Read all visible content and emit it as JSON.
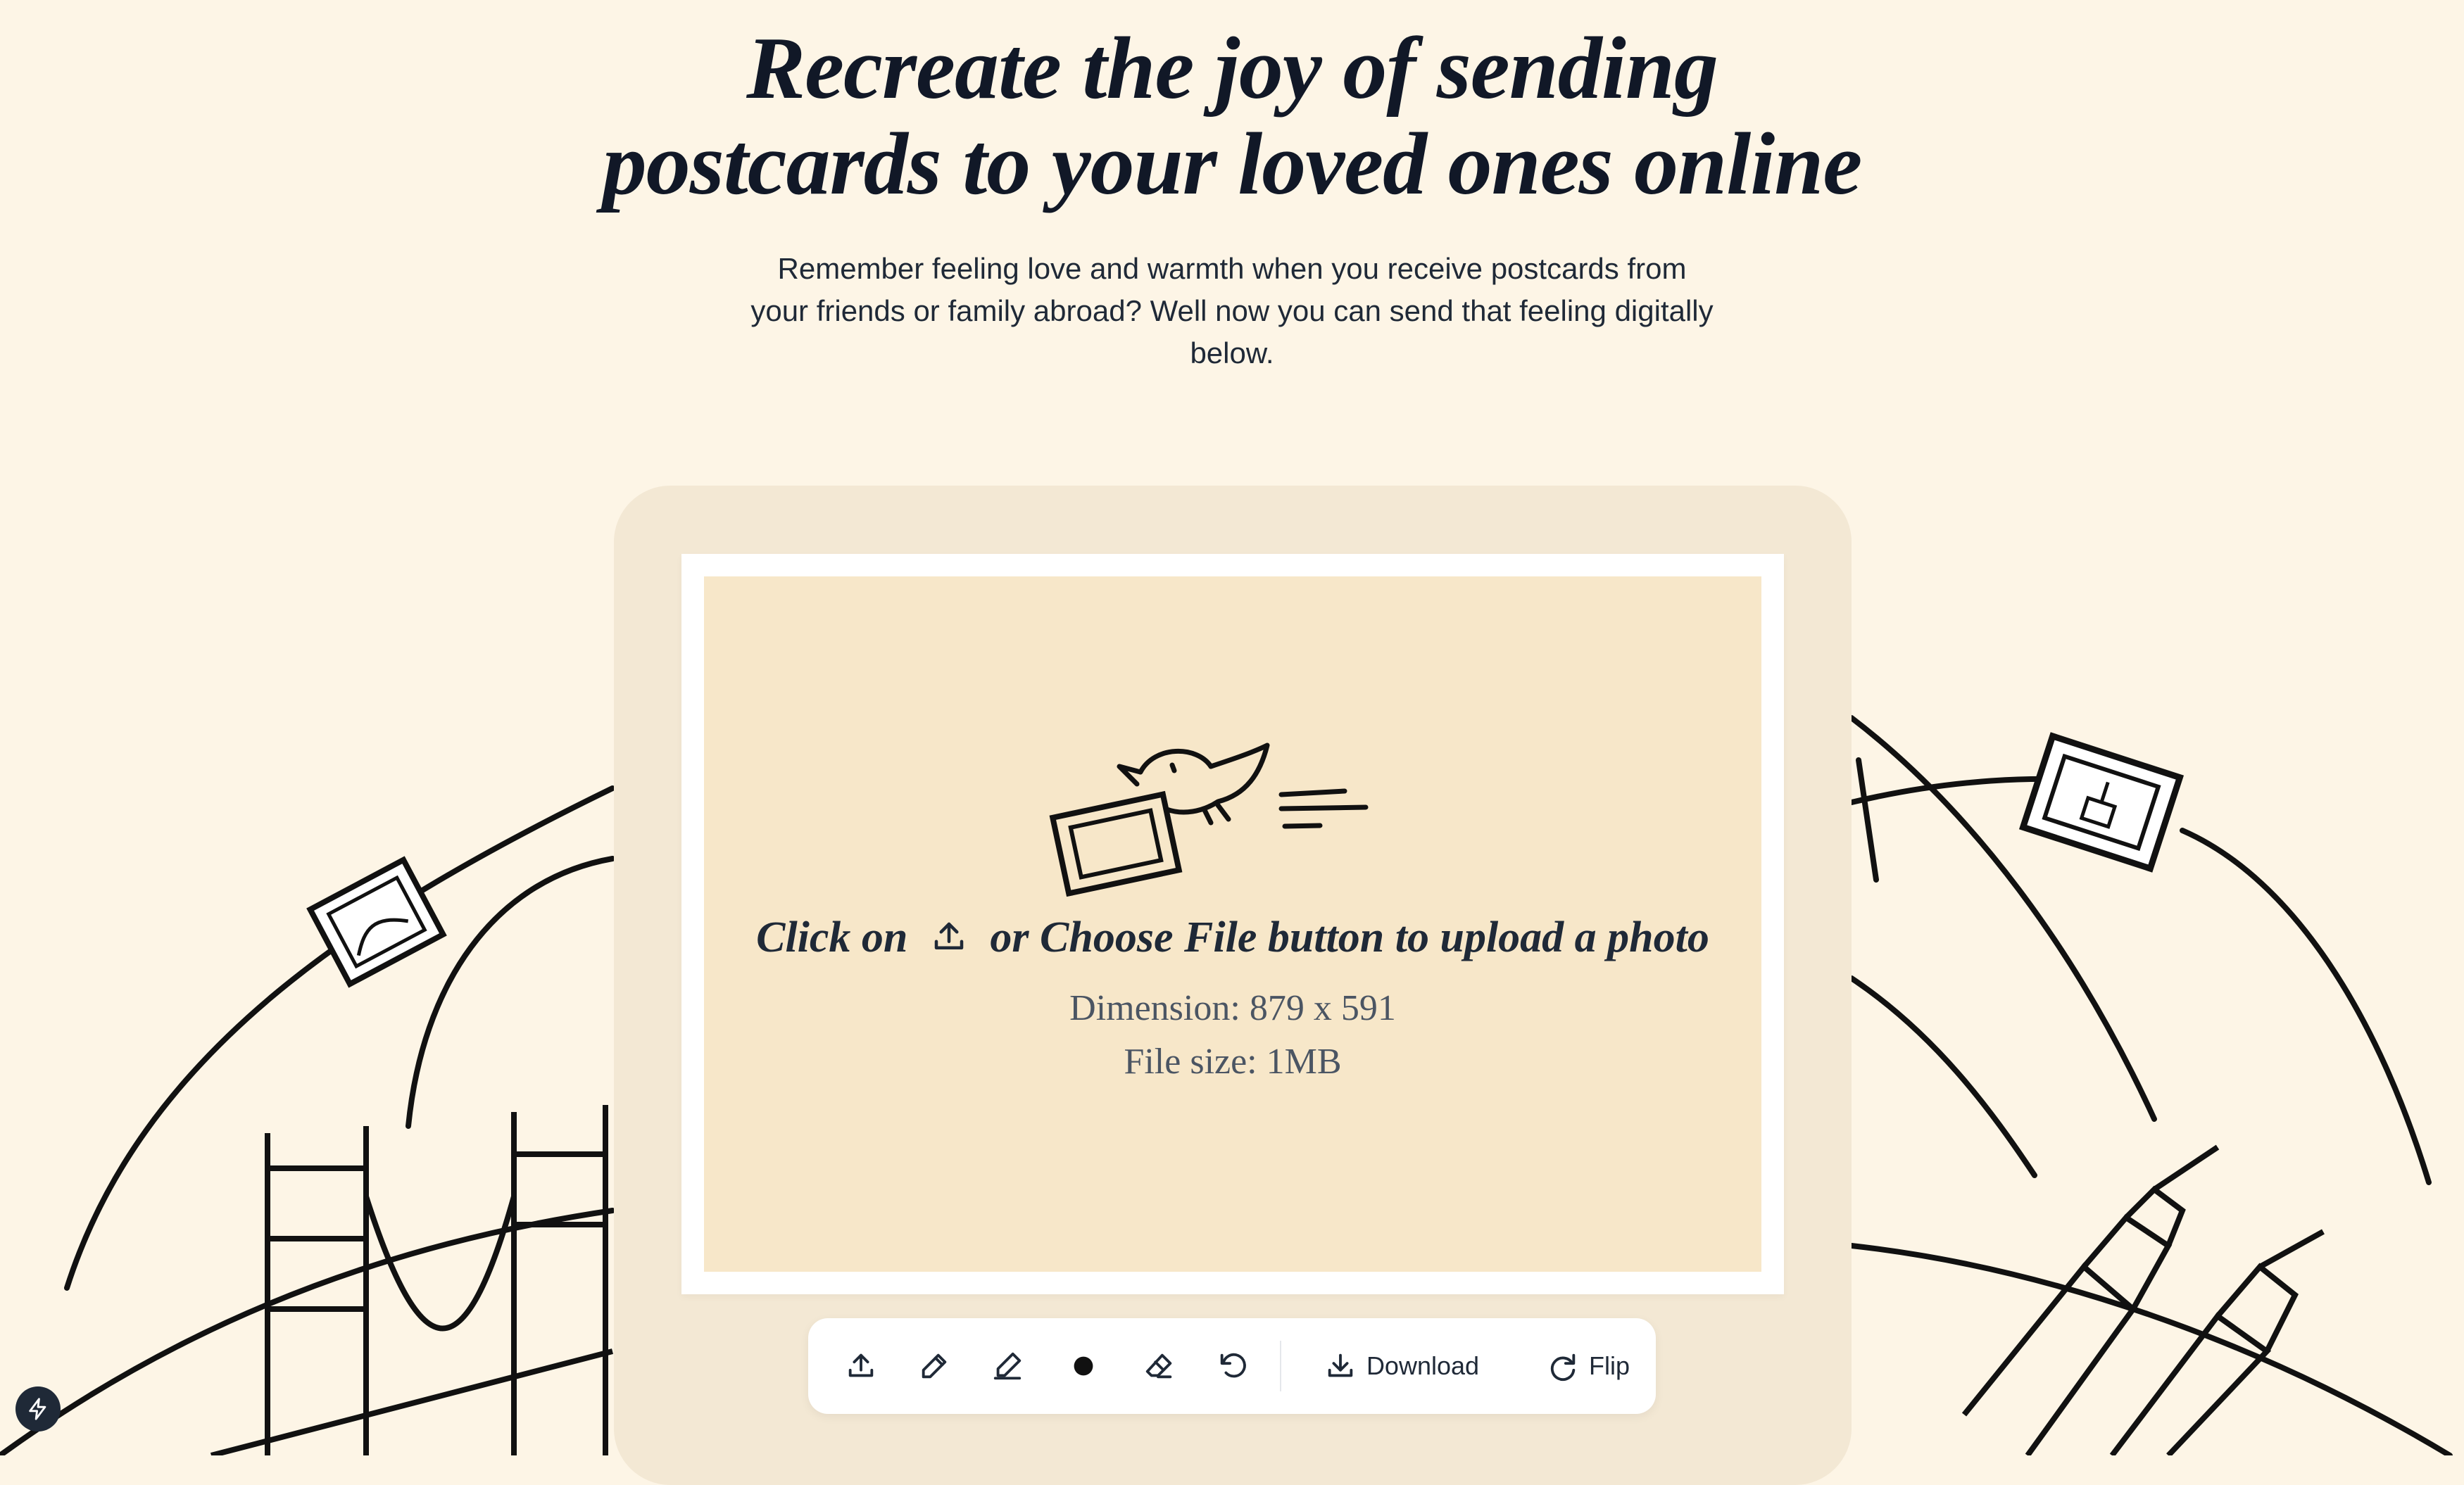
{
  "hero": {
    "title_line1": "Recreate the joy of sending",
    "title_line2": "postcards to your loved ones online",
    "subtitle": "Remember feeling love and warmth when you receive postcards from your friends or family abroad? Well now you can send that feeling digitally below."
  },
  "postcard": {
    "upload_prefix": "Click on",
    "upload_suffix": "or Choose File button to upload a photo",
    "dimension": "Dimension: 879 x 591",
    "file_size": "File size: 1MB"
  },
  "toolbar": {
    "upload_icon": "upload-icon",
    "pencil_icon": "pencil-icon",
    "pen_icon": "pen-icon",
    "color_icon": "color-dot-icon",
    "eraser_icon": "eraser-icon",
    "undo_icon": "undo-icon",
    "download_label": "Download",
    "flip_label": "Flip"
  },
  "colors": {
    "background": "#fdf5e6",
    "panel": "#f3e8d4",
    "card": "#f7e7c9",
    "ink": "#111827"
  }
}
